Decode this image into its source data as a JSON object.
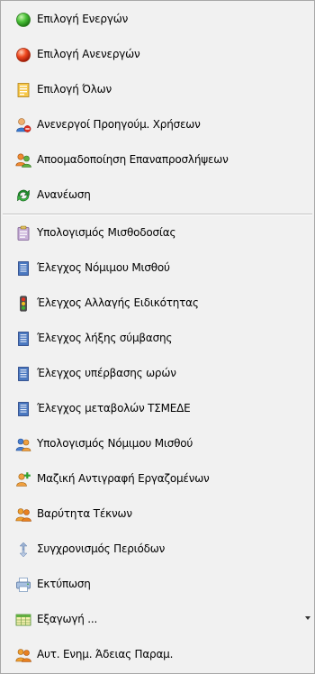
{
  "menu": {
    "items": [
      {
        "label": "Επιλογή Ενεργών",
        "icon": "green-circle-icon"
      },
      {
        "label": "Επιλογή Ανενεργών",
        "icon": "red-circle-icon"
      },
      {
        "label": "Επιλογή Όλων",
        "icon": "document-list-icon"
      },
      {
        "label": "Ανενεργοί Προηγούμ. Χρήσεων",
        "icon": "user-inactive-icon"
      },
      {
        "label": "Αποομαδοποίηση Επαναπροσλήψεων",
        "icon": "users-ungroup-icon"
      },
      {
        "label": "Ανανέωση",
        "icon": "refresh-icon"
      },
      {
        "label": "Υπολογισμός Μισθοδοσίας",
        "icon": "clipboard-icon"
      },
      {
        "label": "Έλεγχος Νόμιμου Μισθού",
        "icon": "report-icon"
      },
      {
        "label": "Έλεγχος Αλλαγής Ειδικότητας",
        "icon": "traffic-light-icon"
      },
      {
        "label": "Έλεγχος  λήξης σύμβασης",
        "icon": "report-icon"
      },
      {
        "label": "Έλεγχος υπέρβασης ωρών",
        "icon": "report-icon"
      },
      {
        "label": "Έλεγχος μεταβολών ΤΣΜΕΔΕ",
        "icon": "report-icon"
      },
      {
        "label": "Υπολογισμός Νόμιμου Μισθού",
        "icon": "users-calc-icon"
      },
      {
        "label": "Μαζική Αντιγραφή Εργαζομένων",
        "icon": "user-add-icon"
      },
      {
        "label": "Βαρύτητα Τέκνων",
        "icon": "users-group-icon"
      },
      {
        "label": "Συγχρονισμός Περιόδων",
        "icon": "sync-icon"
      },
      {
        "label": "Εκτύπωση",
        "icon": "print-icon"
      },
      {
        "label": "Εξαγωγή ...",
        "icon": "spreadsheet-icon"
      },
      {
        "label": "Αυτ. Ενημ. Άδειας Παραμ.",
        "icon": "users-group-icon"
      }
    ]
  },
  "colors": {
    "menu_background": "#f1f1f1",
    "menu_border": "#a8a8a8",
    "separator": "#c4c4c4"
  }
}
